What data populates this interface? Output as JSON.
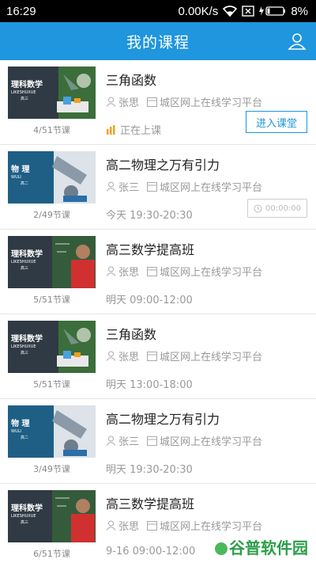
{
  "status_bar": {
    "time": "16:29",
    "speed": "0.00K/s",
    "battery": "8%"
  },
  "header": {
    "title": "我的课程"
  },
  "courses": [
    {
      "title": "三角函数",
      "teacher": "张思",
      "platform": "城区网上在线学习平台",
      "lessons": "4/51节课",
      "thumb_name": "理科数学",
      "thumb_sub": "LIKESHUXUE",
      "thumb_grade": "高三",
      "status_text": "正在上课",
      "button_label": "进入课堂"
    },
    {
      "title": "高二物理之万有引力",
      "teacher": "张三",
      "platform": "城区网上在线学习平台",
      "lessons": "2/49节课",
      "thumb_name": "物 理",
      "thumb_sub": "WULI",
      "thumb_grade": "高二",
      "time": "今天 19:30-20:30",
      "timer": "00:00:00"
    },
    {
      "title": "高三数学提高班",
      "teacher": "张思",
      "platform": "城区网上在线学习平台",
      "lessons": "5/51节课",
      "thumb_name": "理科数学",
      "thumb_sub": "LIKESHUXUE",
      "thumb_grade": "高三",
      "time": "明天 09:00-12:00"
    },
    {
      "title": "三角函数",
      "teacher": "张思",
      "platform": "城区网上在线学习平台",
      "lessons": "5/51节课",
      "thumb_name": "理科数学",
      "thumb_sub": "LIKESHUXUE",
      "thumb_grade": "高三",
      "time": "明天 13:00-18:00"
    },
    {
      "title": "高二物理之万有引力",
      "teacher": "张三",
      "platform": "城区网上在线学习平台",
      "lessons": "3/49节课",
      "thumb_name": "物 理",
      "thumb_sub": "WULI",
      "thumb_grade": "高二",
      "time": "明天 19:30-20:30"
    },
    {
      "title": "高三数学提高班",
      "teacher": "张思",
      "platform": "城区网上在线学习平台",
      "lessons": "6/51节课",
      "thumb_name": "理科数学",
      "thumb_sub": "LIKESHUXUE",
      "thumb_grade": "高三",
      "time": "9-16 09:00-12:00"
    }
  ],
  "watermark": "谷普软件园",
  "colors": {
    "accent": "#1f96dd",
    "live": "#f0a020"
  }
}
